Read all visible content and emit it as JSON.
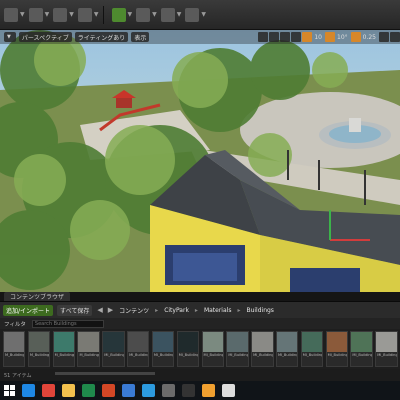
{
  "viewport": {
    "perspective_label": "パースペクティブ",
    "lighting_label": "ライティングあり",
    "show_label": "表示",
    "grid_value": "10",
    "angle_value": "10°",
    "scale_value": "0.25"
  },
  "content_browser": {
    "tab_label": "コンテンツブラウザ",
    "import_button": "追加/インポート",
    "save_all_button": "すべて保存",
    "breadcrumb": [
      "コンテンツ",
      "CityPark",
      "Materials",
      "Buildings"
    ],
    "filter_label": "フィルタ",
    "search_placeholder": "Search Buildings",
    "status_text": "51 アイテム",
    "assets": [
      {
        "label": "M_Buildings_Brick",
        "color": "#6f6f6f"
      },
      {
        "label": "M_Buildings_Wall",
        "color": "#585f58"
      },
      {
        "label": "M_Buildings_Trim",
        "color": "#3d7a6b"
      },
      {
        "label": "M_Buildings_Conc",
        "color": "#7a7a74"
      },
      {
        "label": "MI_Buildings_Glass",
        "color": "#26363a"
      },
      {
        "label": "MI_Buildings_Roof",
        "color": "#4c4c4c"
      },
      {
        "label": "MI_Buildings_Door",
        "color": "#3b5360"
      },
      {
        "label": "MI_Buildings_Frame",
        "color": "#1f2a2c"
      },
      {
        "label": "MI_Buildings_Tile",
        "color": "#7b8a80"
      },
      {
        "label": "MI_Buildings_Metal",
        "color": "#5a6a6c"
      },
      {
        "label": "MI_Buildings_Plaster",
        "color": "#8a8a86"
      },
      {
        "label": "MI_Buildings_Wood",
        "color": "#657577"
      },
      {
        "label": "MI_Buildings_Paint",
        "color": "#456b5a"
      },
      {
        "label": "MI_Buildings_Stone",
        "color": "#8b5a3a"
      },
      {
        "label": "MI_Buildings_Moss",
        "color": "#4f7357"
      },
      {
        "label": "MI_Buildings_Floor",
        "color": "#9a9a96"
      }
    ]
  },
  "taskbar": {
    "apps": [
      {
        "icon": "windows-start-icon",
        "color": "#ffffff"
      },
      {
        "icon": "edge-icon",
        "color": "#1e88e5"
      },
      {
        "icon": "chrome-icon",
        "color": "#e0453a"
      },
      {
        "icon": "explorer-icon",
        "color": "#f2c14e"
      },
      {
        "icon": "excel-icon",
        "color": "#1f8a4c"
      },
      {
        "icon": "powerpoint-icon",
        "color": "#d24726"
      },
      {
        "icon": "store-icon",
        "color": "#3a7bd5"
      },
      {
        "icon": "media-icon",
        "color": "#2c9be0"
      },
      {
        "icon": "editor-icon",
        "color": "#6b6b6b"
      },
      {
        "icon": "terminal-icon",
        "color": "#333333"
      },
      {
        "icon": "photo-icon",
        "color": "#f0a030"
      },
      {
        "icon": "unreal-icon",
        "color": "#dddddd"
      }
    ]
  }
}
